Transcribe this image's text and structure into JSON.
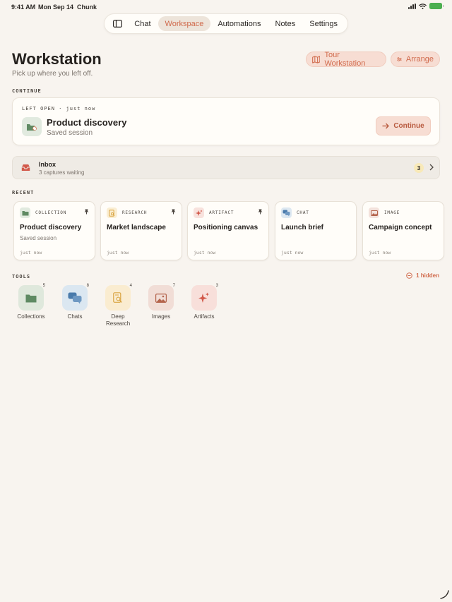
{
  "status_bar": {
    "time": "9:41 AM",
    "date": "Mon Sep 14",
    "app": "Chunk"
  },
  "nav": {
    "tabs": [
      {
        "label": "Chat",
        "active": false
      },
      {
        "label": "Workspace",
        "active": true
      },
      {
        "label": "Automations",
        "active": false
      },
      {
        "label": "Notes",
        "active": false
      },
      {
        "label": "Settings",
        "active": false
      }
    ]
  },
  "header": {
    "title": "Workstation",
    "subtitle": "Pick up where you left off.",
    "tour_button": "Tour Workstation",
    "arrange_button": "Arrange"
  },
  "continue_section": {
    "label": "CONTINUE",
    "meta": "LEFT OPEN · just now",
    "title": "Product discovery",
    "subtitle": "Saved session",
    "button": "Continue"
  },
  "inbox": {
    "title": "Inbox",
    "subtitle": "3 captures waiting",
    "count": "3"
  },
  "recent": {
    "label": "RECENT",
    "cards": [
      {
        "type": "COLLECTION",
        "title": "Product discovery",
        "subtitle": "Saved session",
        "time": "just now",
        "pinned": true,
        "icon": "folder-icon",
        "tint": "#e1eadf",
        "color": "#5f8a63"
      },
      {
        "type": "RESEARCH",
        "title": "Market landscape",
        "subtitle": "",
        "time": "just now",
        "pinned": true,
        "icon": "research-icon",
        "tint": "#faeed3",
        "color": "#d9a441"
      },
      {
        "type": "ARTIFACT",
        "title": "Positioning canvas",
        "subtitle": "",
        "time": "just now",
        "pinned": true,
        "icon": "sparkle-icon",
        "tint": "#f8e2dd",
        "color": "#d2594a"
      },
      {
        "type": "CHAT",
        "title": "Launch brief",
        "subtitle": "",
        "time": "just now",
        "pinned": false,
        "icon": "chat-icon",
        "tint": "#dde8f1",
        "color": "#4a7bab"
      },
      {
        "type": "IMAGE",
        "title": "Campaign concept",
        "subtitle": "",
        "time": "just now",
        "pinned": false,
        "icon": "image-icon",
        "tint": "#f3e2dc",
        "color": "#b4644c"
      }
    ]
  },
  "tools": {
    "label": "TOOLS",
    "hidden": "1 hidden",
    "items": [
      {
        "label": "Collections",
        "count": "5",
        "icon": "folder-icon",
        "tint": "#dfe8dc",
        "color": "#5f8a63"
      },
      {
        "label": "Chats",
        "count": "8",
        "icon": "chat-icon",
        "tint": "#dbe7f1",
        "color": "#4a7bab"
      },
      {
        "label": "Deep Research",
        "count": "4",
        "icon": "research-icon",
        "tint": "#faecd0",
        "color": "#d9a441"
      },
      {
        "label": "Images",
        "count": "7",
        "icon": "image-icon",
        "tint": "#f1ddd6",
        "color": "#b4644c"
      },
      {
        "label": "Artifacts",
        "count": "3",
        "icon": "sparkle-icon",
        "tint": "#f8dfda",
        "color": "#d2594a"
      }
    ]
  },
  "colors": {
    "accent": "#d06a4c",
    "background": "#f8f4ef",
    "card": "#fffdf9"
  }
}
